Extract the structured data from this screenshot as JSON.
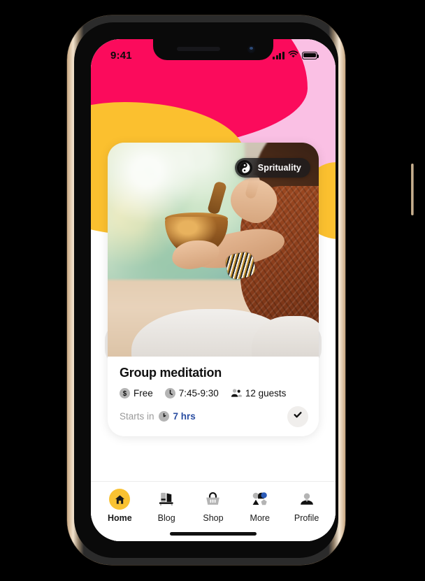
{
  "device": {
    "frame_color": "#c9a882",
    "screen_bg": "#ffffff",
    "buttons": [
      "silent-switch",
      "volume-up",
      "volume-down",
      "power"
    ]
  },
  "wallpaper": {
    "colors": {
      "pink": "#fb0b5c",
      "light_pink": "#fac0e4",
      "yellow": "#fbc02f",
      "white": "#ffffff"
    }
  },
  "status_bar": {
    "time": "9:41",
    "cellular_icon": "signal-bars-icon",
    "wifi_icon": "wifi-icon",
    "battery_icon": "battery-icon"
  },
  "card": {
    "badge": {
      "label": "Sprituality",
      "icon": "yin-yang-icon"
    },
    "photo_alt": "person holding singing bowl in meditation",
    "title": "Group meditation",
    "meta": [
      {
        "icon": "dollar-icon",
        "text": "Free"
      },
      {
        "icon": "clock-icon",
        "text": "7:45-9:30"
      },
      {
        "icon": "guests-icon",
        "text": "12 guests"
      }
    ],
    "footer": {
      "prefix": "Starts in",
      "timer_icon": "timer-icon",
      "value": "7 hrs",
      "value_color": "#2b4ea2",
      "action_icon": "check-icon"
    }
  },
  "tab_bar": {
    "active_index": 0,
    "active_color": "#f9c232",
    "items": [
      {
        "label": "Home",
        "icon": "home-icon"
      },
      {
        "label": "Blog",
        "icon": "blog-icon"
      },
      {
        "label": "Shop",
        "icon": "basket-icon"
      },
      {
        "label": "More",
        "icon": "more-shapes-icon"
      },
      {
        "label": "Profile",
        "icon": "person-icon"
      }
    ]
  }
}
